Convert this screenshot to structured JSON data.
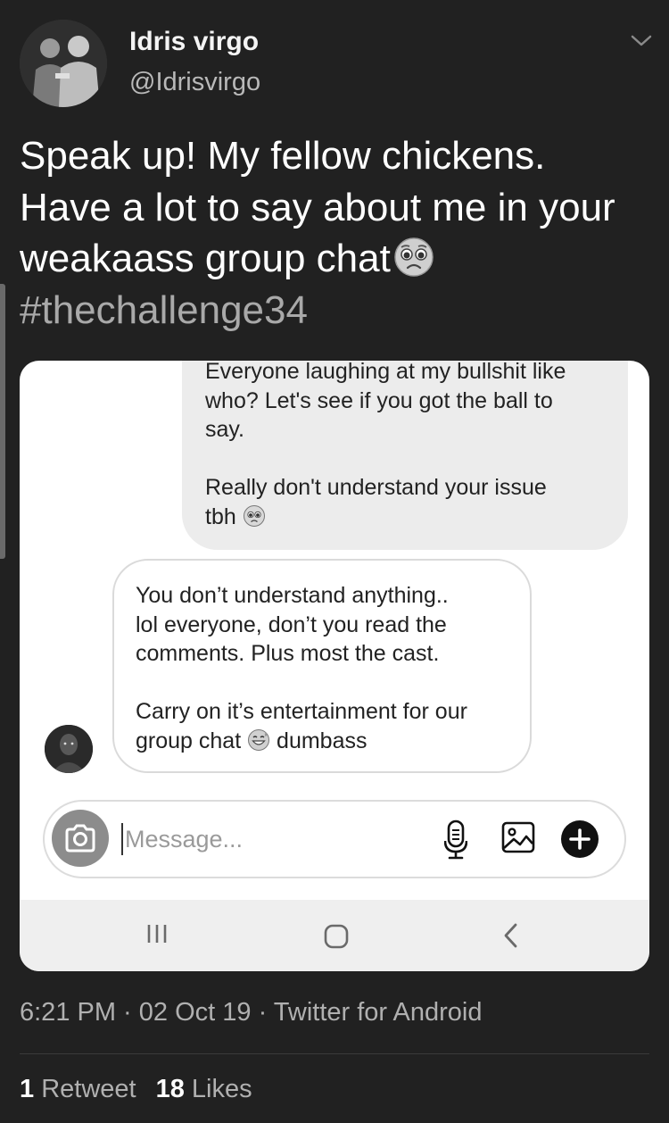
{
  "tweet": {
    "display_name": "Idris virgo",
    "handle": "@Idrisvirgo",
    "text_line1": "Speak up! My fellow chickens.",
    "text_line2": "Have a lot to say about me in your",
    "text_line3": "weakaass group chat",
    "hashtag": "#thechallenge34",
    "timestamp": "6:21 PM · 02 Oct 19 · Twitter for Android",
    "retweets_count": "1",
    "retweets_label": "Retweet",
    "likes_count": "18",
    "likes_label": "Likes"
  },
  "screenshot": {
    "sent_message_1": "Everyone laughing at my bullshit like\nwho? Let's see if you got the ball to\nsay.\n\nReally don't understand your issue\ntbh",
    "received_message_1": "You don’t understand anything..\nlol everyone, don’t you read the\ncomments. Plus most the cast.\n\nCarry on it’s entertainment for our\ngroup chat",
    "received_message_2": "dumbass",
    "composer_placeholder": "Message..."
  },
  "icons": {
    "chevron": "chevron-down-icon",
    "emoji_tweet": "pleading-face-emoji",
    "emoji_sent": "pleading-face-emoji",
    "emoji_received": "grinning-sweat-emoji",
    "camera": "camera-icon",
    "mic": "microphone-icon",
    "gallery": "image-icon",
    "plus": "plus-circle-icon",
    "nav_recent": "recent-apps-icon",
    "nav_home": "home-icon",
    "nav_back": "back-icon"
  }
}
